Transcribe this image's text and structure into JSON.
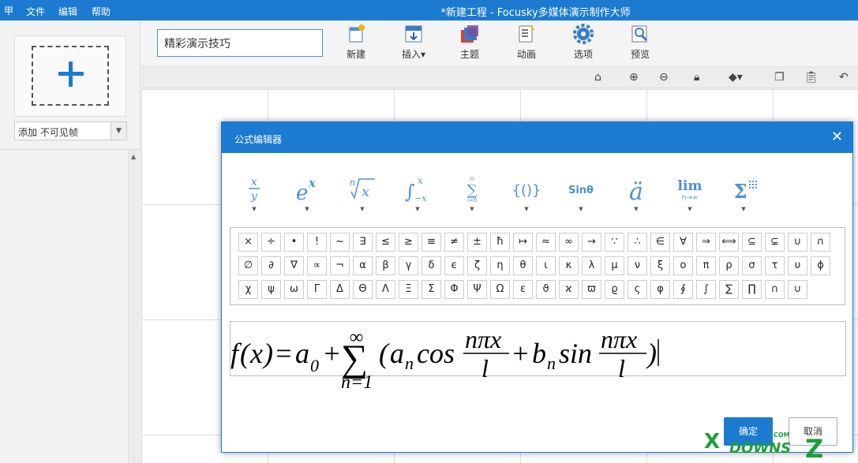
{
  "app": {
    "title": "*新建工程 - Focusky多媒体演示制作大师",
    "icon_glyph": "甲",
    "menus": [
      "文件",
      "编辑",
      "帮助"
    ]
  },
  "left_panel": {
    "add_frame_select": "添加 不可见帧"
  },
  "toolbar": {
    "project_title": "精彩演示技巧",
    "buttons": [
      {
        "label": "新建",
        "icon": "new-icon"
      },
      {
        "label": "插入▾",
        "icon": "insert-icon"
      },
      {
        "label": "主题",
        "icon": "theme-icon"
      },
      {
        "label": "动画",
        "icon": "animation-icon"
      },
      {
        "label": "选项",
        "icon": "gear-icon"
      },
      {
        "label": "预览",
        "icon": "preview-icon"
      }
    ]
  },
  "dialog": {
    "title": "公式编辑器",
    "close": "✕",
    "templates": [
      {
        "name": "fraction",
        "display": "x/y"
      },
      {
        "name": "exponent",
        "display": "eˣ"
      },
      {
        "name": "root",
        "display": "ⁿ√x"
      },
      {
        "name": "integral",
        "display": "∫"
      },
      {
        "name": "summation",
        "display": "∑"
      },
      {
        "name": "brackets",
        "display": "{()}"
      },
      {
        "name": "function",
        "display": "Sinθ"
      },
      {
        "name": "accent",
        "display": "ä"
      },
      {
        "name": "limit",
        "display": "lim"
      },
      {
        "name": "matrix-sum",
        "display": "Σ"
      }
    ],
    "symbols": [
      [
        "×",
        "÷",
        "•",
        "!",
        "~",
        "∃",
        "≤",
        "≥",
        "≡",
        "≠",
        "±",
        "ħ",
        "↦",
        "≈",
        "∞",
        "→",
        "∵",
        "∴",
        "∈",
        "∀",
        "⇒",
        "⟺",
        "⊆",
        "⊊",
        "∪",
        "∩"
      ],
      [
        "∅",
        "∂",
        "∇",
        "∝",
        "¬",
        "α",
        "β",
        "γ",
        "δ",
        "ϵ",
        "ζ",
        "η",
        "θ",
        "ι",
        "κ",
        "λ",
        "μ",
        "ν",
        "ξ",
        "ο",
        "π",
        "ρ",
        "σ",
        "τ",
        "υ",
        "ϕ"
      ],
      [
        "χ",
        "ψ",
        "ω",
        "Γ",
        "Δ",
        "Θ",
        "Λ",
        "Ξ",
        "Σ",
        "Φ",
        "Ψ",
        "Ω",
        "ε",
        "ϑ",
        "ϰ",
        "ϖ",
        "ϱ",
        "ς",
        "φ",
        "∮",
        "∫",
        "∑",
        "∏",
        "∩",
        "∪"
      ]
    ],
    "formula": {
      "f": "f",
      "x": "x",
      "eq": "=",
      "a": "a",
      "sub0": "0",
      "plus": "+",
      "sum_top": "∞",
      "sum": "∑",
      "sum_bottom": "n=1",
      "lp": "(",
      "an": "a",
      "n": "n",
      "cos": "cos",
      "num": "nπx",
      "den": "l",
      "b": "b",
      "sin": "sin",
      "rp": ")"
    },
    "ok_label": "确定",
    "cancel_label": "取消"
  },
  "colors": {
    "accent": "#1c7bd0",
    "watermark": "#1e9e3a"
  }
}
